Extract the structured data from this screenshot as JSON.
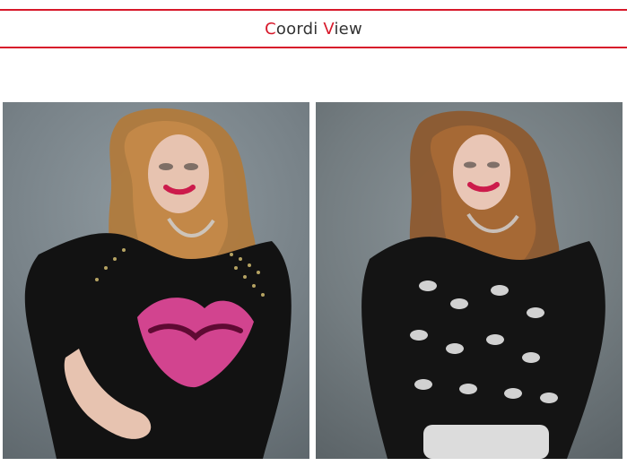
{
  "header": {
    "title_prefix_accent": "C",
    "title_part1": "oordi ",
    "title_mid_accent": "V",
    "title_part2": "iew"
  },
  "theme": {
    "accent": "#d7182a"
  },
  "gallery": {
    "left_image_name": "model-left-photo",
    "right_image_name": "model-right-photo"
  }
}
